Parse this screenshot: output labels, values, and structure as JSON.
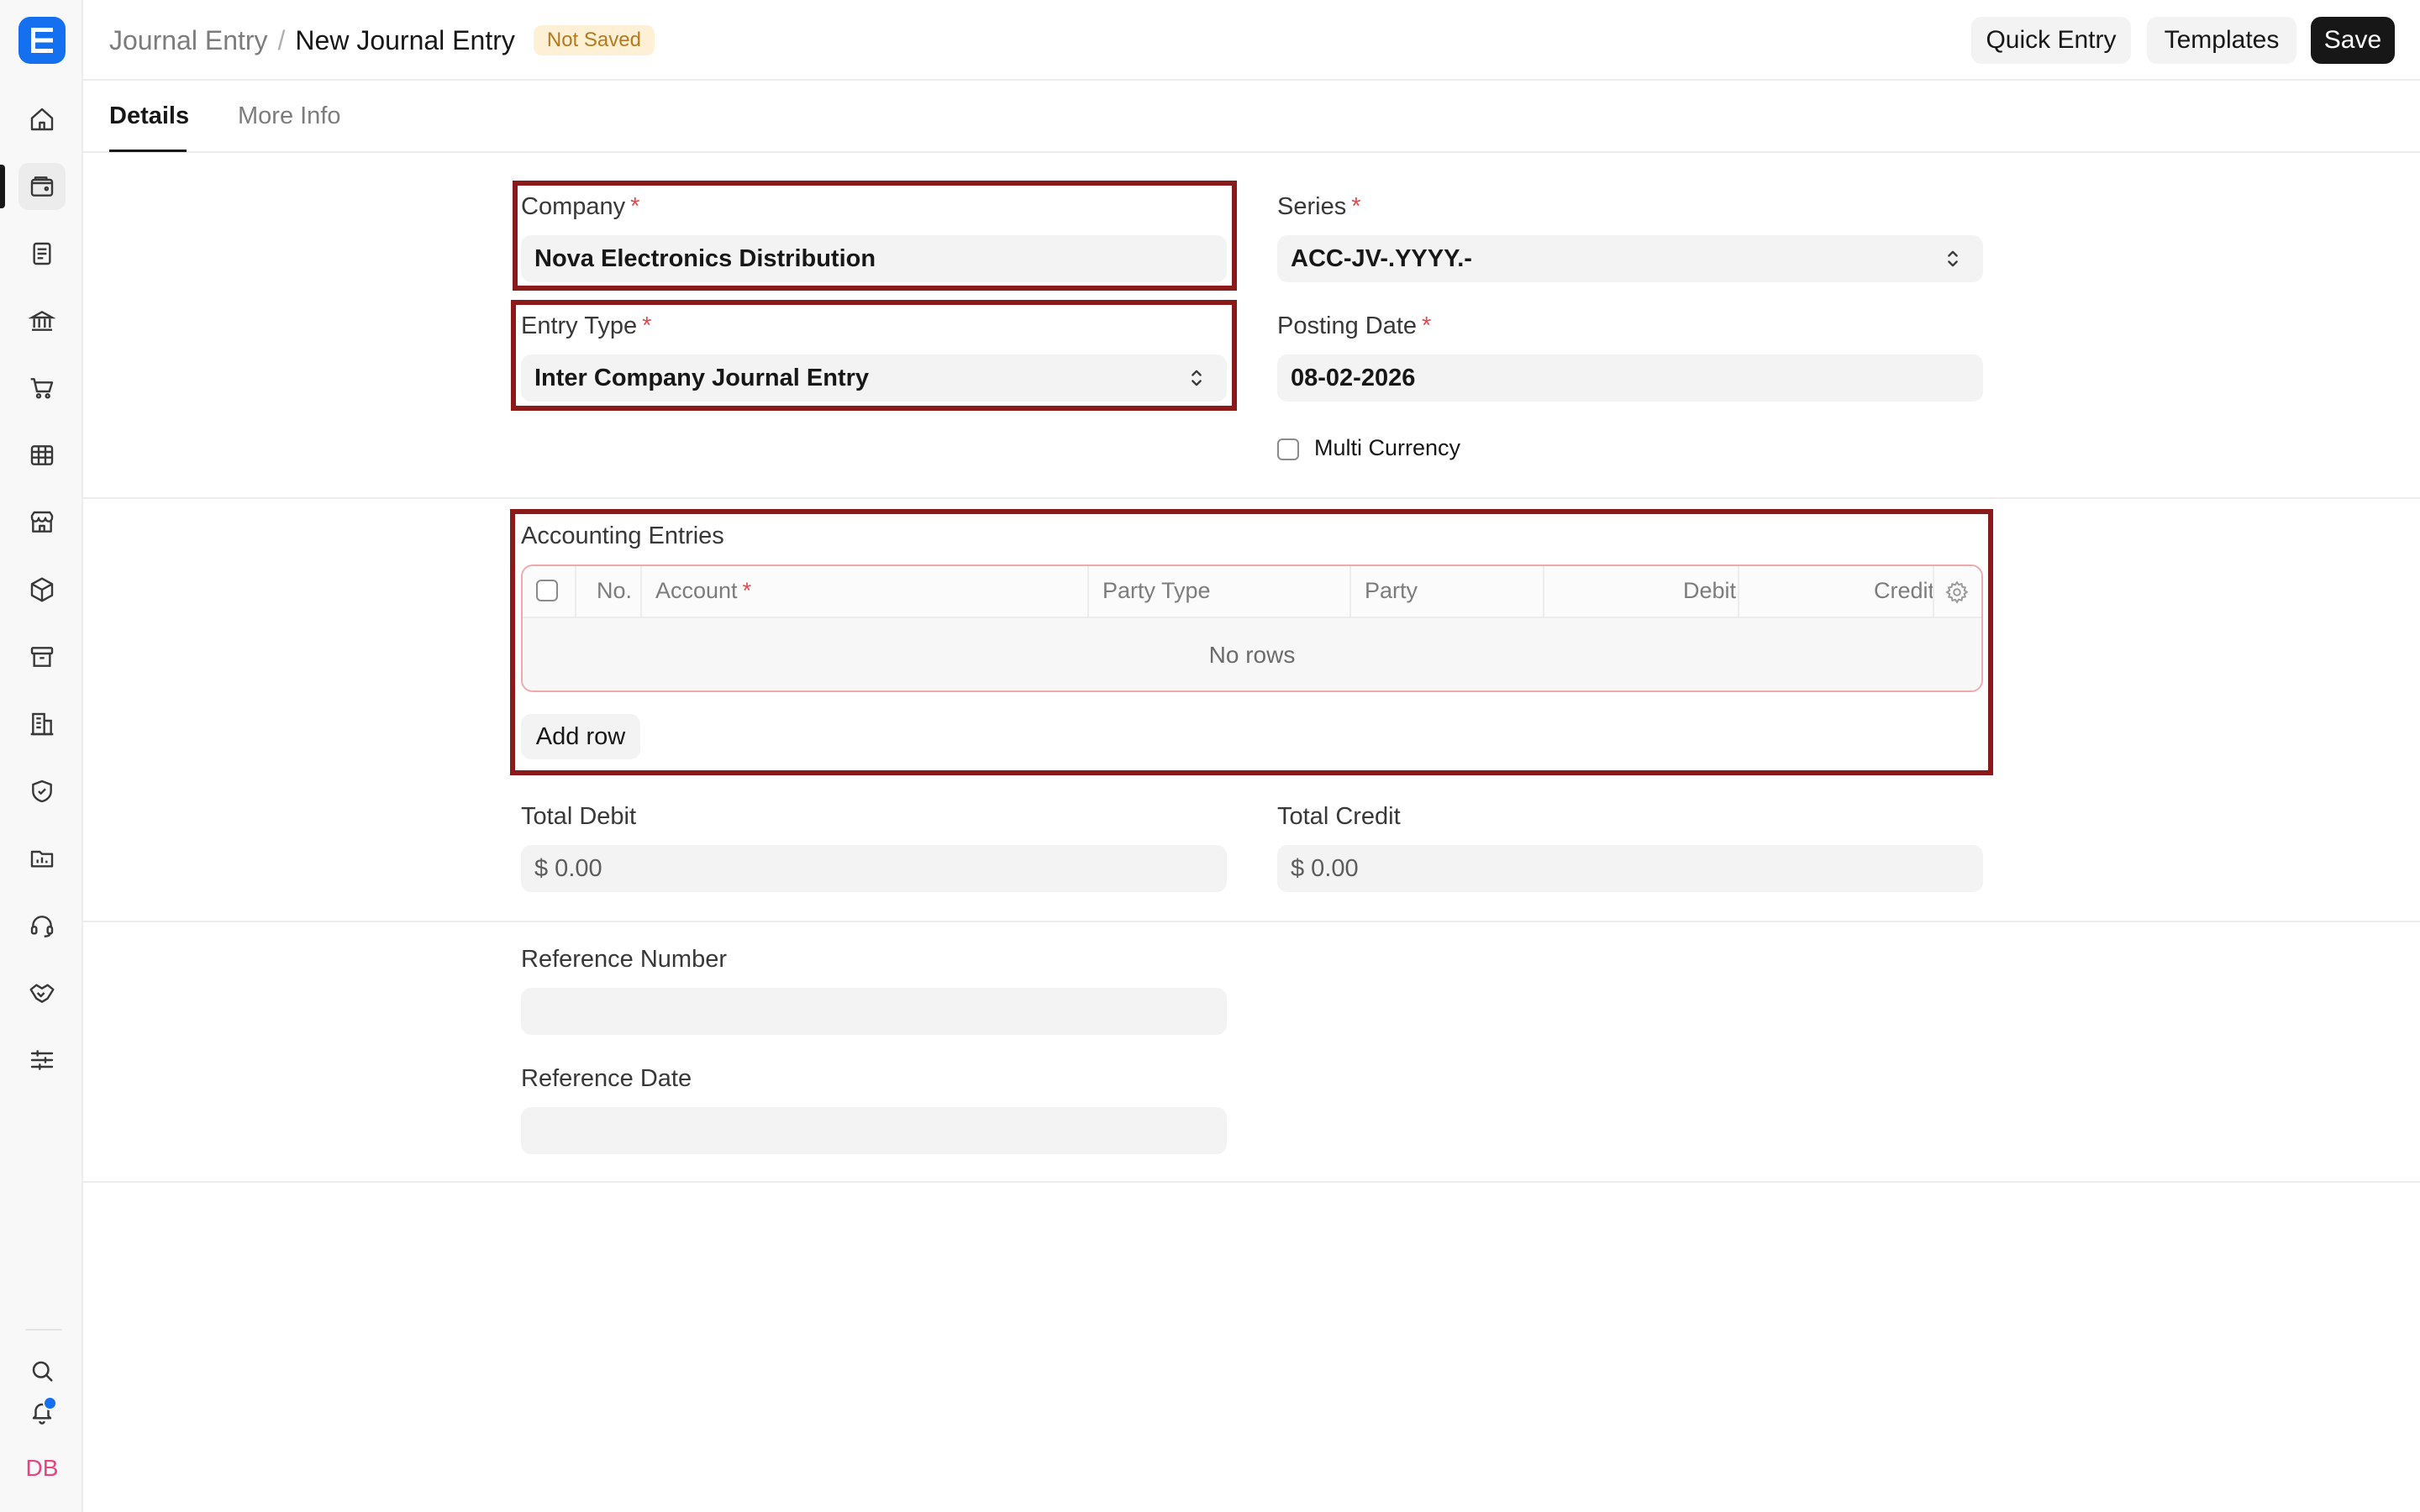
{
  "breadcrumb": {
    "parent": "Journal Entry",
    "separator": "/",
    "current": "New Journal Entry",
    "status_badge": "Not Saved"
  },
  "header_actions": {
    "quick_entry": "Quick Entry",
    "templates": "Templates",
    "save": "Save"
  },
  "tabs": [
    {
      "label": "Details",
      "active": true
    },
    {
      "label": "More Info",
      "active": false
    }
  ],
  "sidebar": {
    "logo_letter": "E",
    "icons": [
      "home-icon",
      "wallet-icon",
      "document-icon",
      "bank-icon",
      "cart-icon",
      "table-icon",
      "store-icon",
      "package-icon",
      "archive-icon",
      "building-icon",
      "shield-icon",
      "folder-chart-icon",
      "headset-icon",
      "handshake-icon",
      "sliders-icon"
    ],
    "active_icon": "wallet-icon",
    "bottom": {
      "search": "search-icon",
      "notifications": "bell-icon",
      "avatar_initials": "DB"
    }
  },
  "form": {
    "company": {
      "label": "Company",
      "required_mark": "*",
      "value": "Nova Electronics Distribution"
    },
    "series": {
      "label": "Series",
      "required_mark": "*",
      "value": "ACC-JV-.YYYY.-"
    },
    "entry_type": {
      "label": "Entry Type",
      "required_mark": "*",
      "value": "Inter Company Journal Entry"
    },
    "posting_date": {
      "label": "Posting Date",
      "required_mark": "*",
      "value": "08-02-2026"
    },
    "multi_currency": {
      "label": "Multi Currency",
      "checked": false
    },
    "accounting_entries": {
      "label": "Accounting Entries",
      "columns": {
        "no": "No.",
        "account": "Account",
        "account_required": "*",
        "party_type": "Party Type",
        "party": "Party",
        "debit": "Debit",
        "credit": "Credit"
      },
      "empty_text": "No rows",
      "add_row": "Add row"
    },
    "total_debit": {
      "label": "Total Debit",
      "value": "$ 0.00"
    },
    "total_credit": {
      "label": "Total Credit",
      "value": "$ 0.00"
    },
    "reference_number": {
      "label": "Reference Number",
      "value": ""
    },
    "reference_date": {
      "label": "Reference Date",
      "value": ""
    }
  },
  "colors": {
    "accent": "#1570ef",
    "highlight_border": "#8b1a1a",
    "required": "#e5484d",
    "badge_bg": "#fdf0d4",
    "badge_text": "#b7791f"
  }
}
